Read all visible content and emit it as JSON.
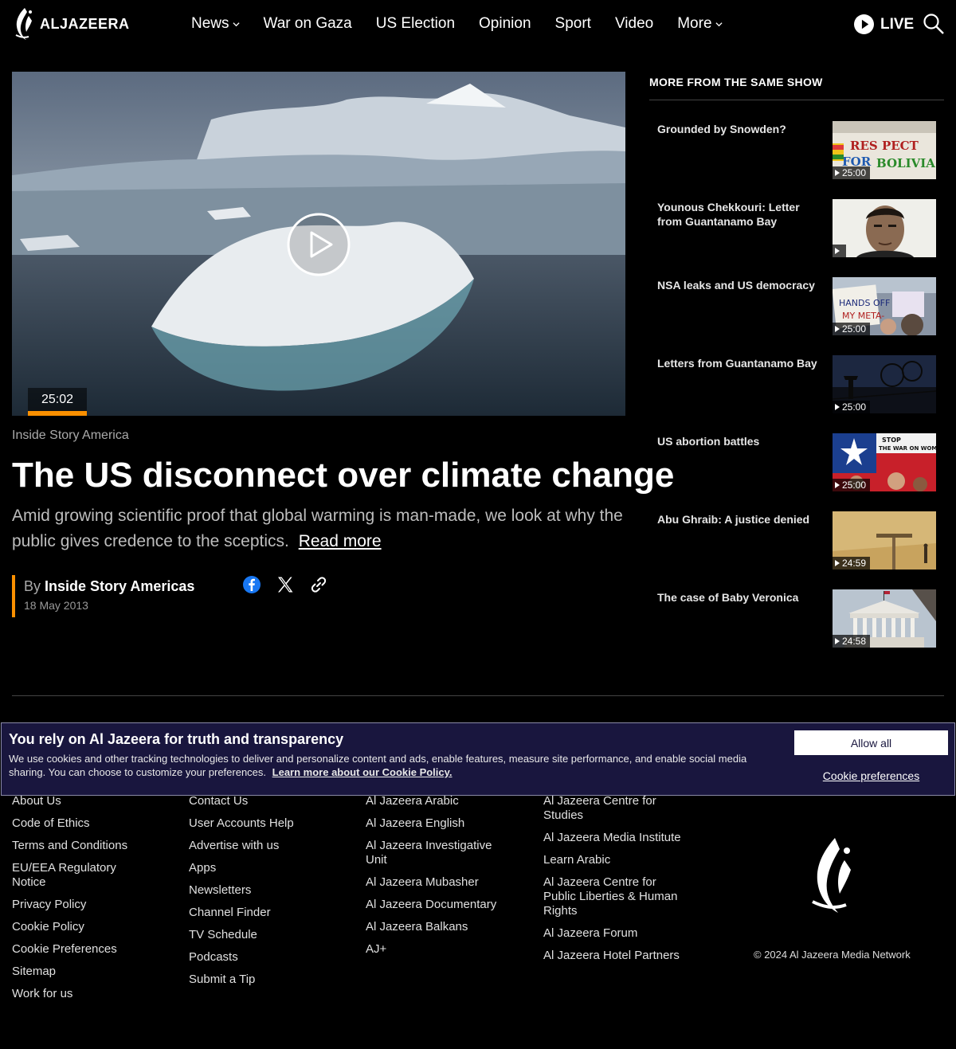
{
  "header": {
    "logo_text": "ALJAZEERA",
    "nav": [
      {
        "label": "News",
        "dropdown": true
      },
      {
        "label": "War on Gaza",
        "dropdown": false
      },
      {
        "label": "US Election",
        "dropdown": false
      },
      {
        "label": "Opinion",
        "dropdown": false
      },
      {
        "label": "Sport",
        "dropdown": false
      },
      {
        "label": "Video",
        "dropdown": false
      },
      {
        "label": "More",
        "dropdown": true
      }
    ],
    "live_label": "LIVE"
  },
  "article": {
    "duration": "25:02",
    "show": "Inside Story America",
    "headline": "The US disconnect over climate change",
    "summary": "Amid growing scientific proof that global warming is man-made, we look at why the public gives credence to the sceptics.",
    "read_more": "Read more",
    "byline_prefix": "By",
    "author": "Inside Story Americas",
    "date": "18 May 2013"
  },
  "sidebar": {
    "title": "MORE FROM THE SAME SHOW",
    "items": [
      {
        "title": "Grounded by Snowden?",
        "duration": "25:00"
      },
      {
        "title": "Younous Chekkouri: Letter from Guantanamo Bay",
        "duration": ""
      },
      {
        "title": "NSA leaks and US democracy",
        "duration": "25:00"
      },
      {
        "title": "Letters from Guantanamo Bay",
        "duration": "25:00"
      },
      {
        "title": "US abortion battles",
        "duration": "25:00"
      },
      {
        "title": "Abu Ghraib: A justice denied",
        "duration": "24:59"
      },
      {
        "title": "The case of Baby Veronica",
        "duration": "24:58"
      }
    ]
  },
  "cookie": {
    "title": "You rely on Al Jazeera for truth and transparency",
    "text": "We use cookies and other tracking technologies to deliver and personalize content and ads, enable features, measure site performance, and enable social media sharing. You can choose to customize your preferences.",
    "policy_link": "Learn more about our Cookie Policy.",
    "allow_all": "Allow all",
    "preferences": "Cookie preferences"
  },
  "footer": {
    "col1": [
      "About Us",
      "Code of Ethics",
      "Terms and Conditions",
      "EU/EEA Regulatory Notice",
      "Privacy Policy",
      "Cookie Policy",
      "Cookie Preferences",
      "Sitemap",
      "Work for us"
    ],
    "col2": [
      "Contact Us",
      "User Accounts Help",
      "Advertise with us",
      "Apps",
      "Newsletters",
      "Channel Finder",
      "TV Schedule",
      "Podcasts",
      "Submit a Tip"
    ],
    "col3": [
      "Al Jazeera Arabic",
      "Al Jazeera English",
      "Al Jazeera Investigative Unit",
      "Al Jazeera Mubasher",
      "Al Jazeera Documentary",
      "Al Jazeera Balkans",
      "AJ+"
    ],
    "col4": [
      "Al Jazeera Centre for Studies",
      "Al Jazeera Media Institute",
      "Learn Arabic",
      "Al Jazeera Centre for Public Liberties & Human Rights",
      "Al Jazeera Forum",
      "Al Jazeera Hotel Partners"
    ],
    "copyright": "© 2024 Al Jazeera Media Network"
  },
  "colors": {
    "accent": "#fa9000",
    "cookie_bg": "#19163e"
  }
}
